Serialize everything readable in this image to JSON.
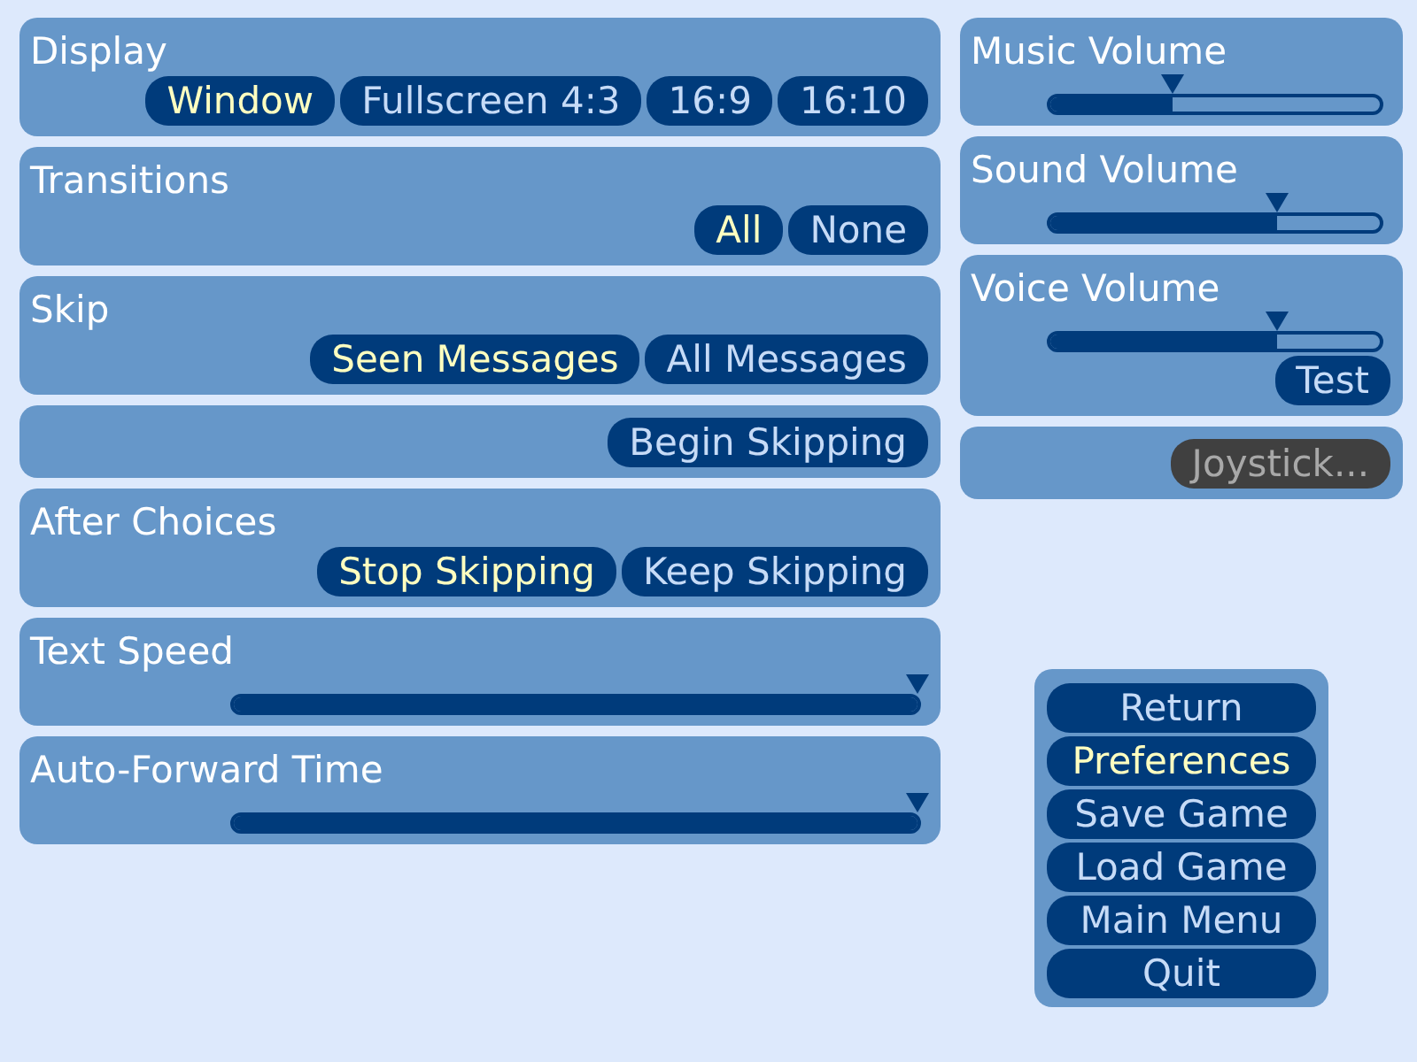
{
  "left_panels": [
    {
      "kind": "choice",
      "title": "Display",
      "options": [
        {
          "label": "Window",
          "selected": true
        },
        {
          "label": "Fullscreen 4:3",
          "selected": false
        },
        {
          "label": "16:9",
          "selected": false
        },
        {
          "label": "16:10",
          "selected": false
        }
      ]
    },
    {
      "kind": "choice",
      "title": "Transitions",
      "options": [
        {
          "label": "All",
          "selected": true
        },
        {
          "label": "None",
          "selected": false
        }
      ]
    },
    {
      "kind": "choice",
      "title": "Skip",
      "options": [
        {
          "label": "Seen Messages",
          "selected": true
        },
        {
          "label": "All Messages",
          "selected": false
        }
      ]
    },
    {
      "kind": "action",
      "button": {
        "label": "Begin Skipping",
        "disabled": false
      }
    },
    {
      "kind": "choice",
      "title": "After Choices",
      "options": [
        {
          "label": "Stop Skipping",
          "selected": true
        },
        {
          "label": "Keep Skipping",
          "selected": false
        }
      ]
    },
    {
      "kind": "slider",
      "title": "Text Speed",
      "level": 1
    },
    {
      "kind": "slider",
      "title": "Auto-Forward Time",
      "level": 1
    }
  ],
  "right_panels": [
    {
      "kind": "slider",
      "title": "Music Volume",
      "level": 0.37
    },
    {
      "kind": "slider",
      "title": "Sound Volume",
      "level": 0.69
    },
    {
      "kind": "slider",
      "title": "Voice Volume",
      "level": 0.69,
      "button": {
        "label": "Test",
        "disabled": false
      }
    },
    {
      "kind": "action",
      "button": {
        "label": "Joystick...",
        "disabled": true
      }
    }
  ],
  "menu": [
    {
      "label": "Return",
      "selected": false
    },
    {
      "label": "Preferences",
      "selected": true
    },
    {
      "label": "Save Game",
      "selected": false
    },
    {
      "label": "Load Game",
      "selected": false
    },
    {
      "label": "Main Menu",
      "selected": false
    },
    {
      "label": "Quit",
      "selected": false
    }
  ]
}
